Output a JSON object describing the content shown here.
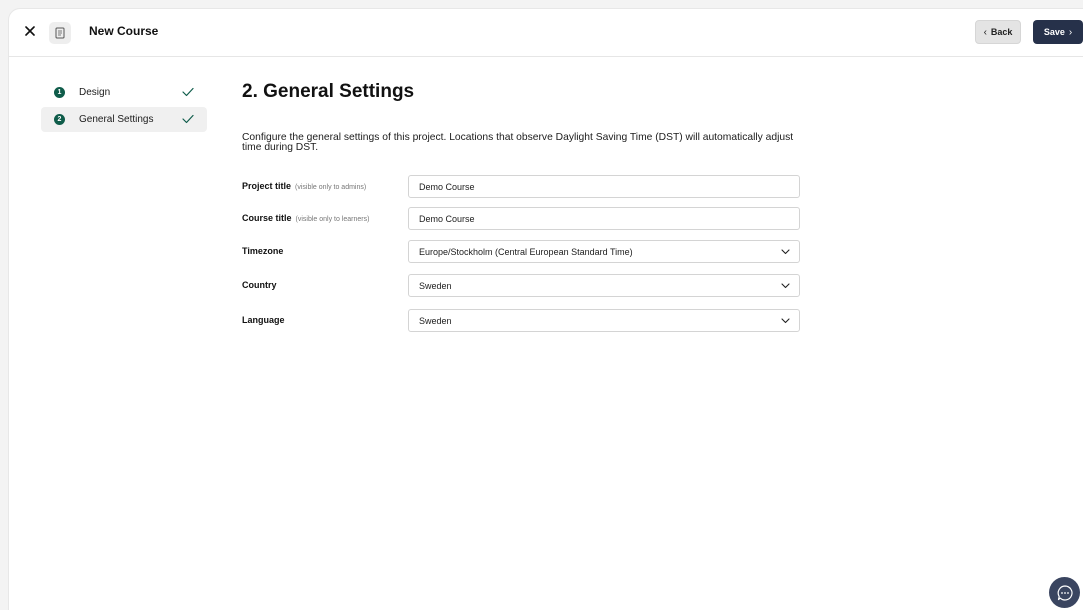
{
  "header": {
    "title": "New Course",
    "back_label": "Back",
    "save_label": "Save",
    "icons": {
      "close": "close-icon",
      "document": "document-icon"
    }
  },
  "stepper": {
    "steps": [
      {
        "number": "1",
        "label": "Design",
        "completed": true,
        "active": false
      },
      {
        "number": "2",
        "label": "General Settings",
        "completed": true,
        "active": true
      }
    ]
  },
  "main": {
    "heading": "2. General Settings",
    "description": "Configure the general settings of this project. Locations that observe Daylight Saving Time (DST) will automatically adjust time during DST.",
    "fields": {
      "project_title": {
        "label": "Project title",
        "hint": "(visible only to admins)",
        "value": "Demo Course"
      },
      "course_title": {
        "label": "Course title",
        "hint": "(visible only to learners)",
        "value": "Demo Course"
      },
      "timezone": {
        "label": "Timezone",
        "value": "Europe/Stockholm (Central European Standard Time)"
      },
      "country": {
        "label": "Country",
        "value": "Sweden"
      },
      "language": {
        "label": "Language",
        "value": "Sweden"
      }
    }
  },
  "colors": {
    "accent": "#0f5c4a",
    "primary_button": "#26314a",
    "chat_button": "#3a4560"
  }
}
